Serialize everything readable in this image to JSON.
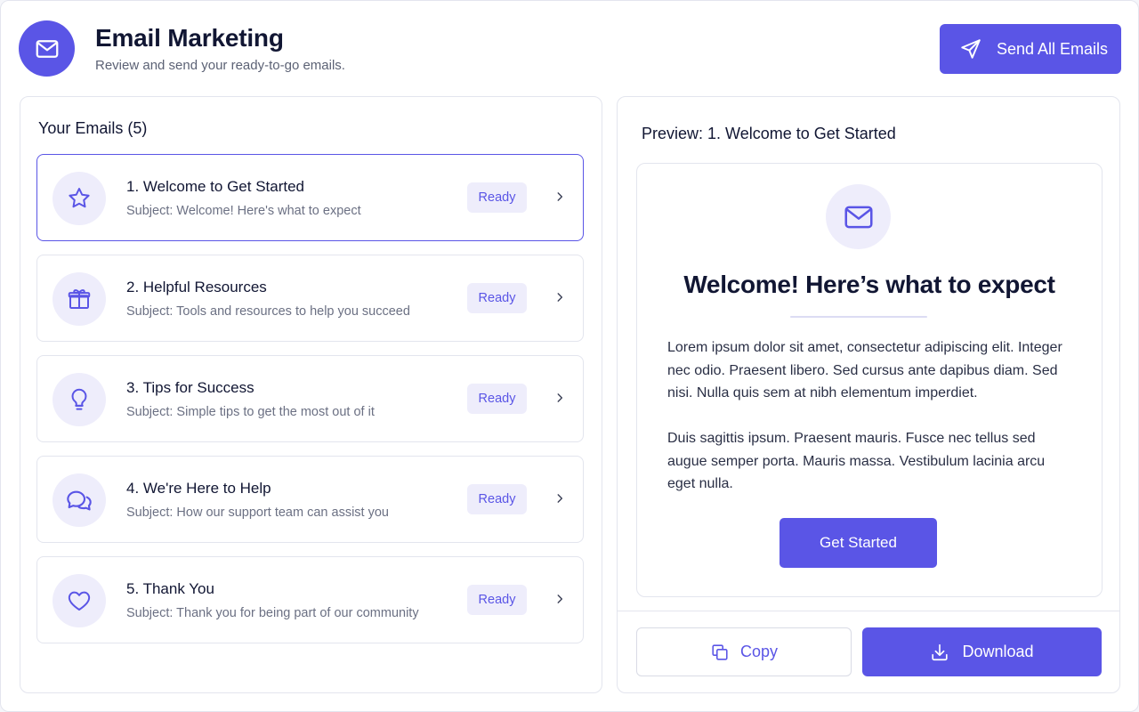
{
  "header": {
    "title": "Email Marketing",
    "subtitle": "Review and send your ready-to-go emails.",
    "icon": "mail-icon",
    "send_all_label": "Send All Emails",
    "send_all_icon": "send-icon"
  },
  "email_list": {
    "title": "Your Emails (5)",
    "items": [
      {
        "title": "1. Welcome to Get Started",
        "subject": "Subject: Welcome! Here's what to expect",
        "status": "Ready",
        "icon": "star-icon",
        "selected": true
      },
      {
        "title": "2. Helpful Resources",
        "subject": "Subject: Tools and resources to help you succeed",
        "status": "Ready",
        "icon": "gift-icon",
        "selected": false
      },
      {
        "title": "3. Tips for Success",
        "subject": "Subject: Simple tips to get the most out of it",
        "status": "Ready",
        "icon": "lightbulb-icon",
        "selected": false
      },
      {
        "title": "4. We're Here to Help",
        "subject": "Subject: How our support team can assist you",
        "status": "Ready",
        "icon": "chat-icon",
        "selected": false
      },
      {
        "title": "5. Thank You",
        "subject": "Subject: Thank you for being part of our community",
        "status": "Ready",
        "icon": "heart-icon",
        "selected": false
      }
    ]
  },
  "preview": {
    "title": "Preview: 1. Welcome to Get Started",
    "icon": "mail-icon",
    "heading": "Welcome! Here’s what to expect",
    "paragraph1": "Lorem ipsum dolor sit amet, consectetur adipiscing elit. Integer nec odio. Praesent libero. Sed cursus ante dapibus diam. Sed nisi. Nulla quis sem at nibh elementum imperdiet.",
    "paragraph2": "Duis sagittis ipsum. Praesent mauris. Fusce nec tellus sed augue semper porta. Mauris massa. Vestibulum lacinia arcu eget nulla.",
    "cta_label": "Get Started",
    "copy_label": "Copy",
    "download_label": "Download"
  },
  "colors": {
    "accent": "#5a55e6",
    "accent_soft": "#eeedfb",
    "text_primary": "#111633",
    "text_secondary": "#6b7083",
    "border": "#e3e5ee"
  }
}
